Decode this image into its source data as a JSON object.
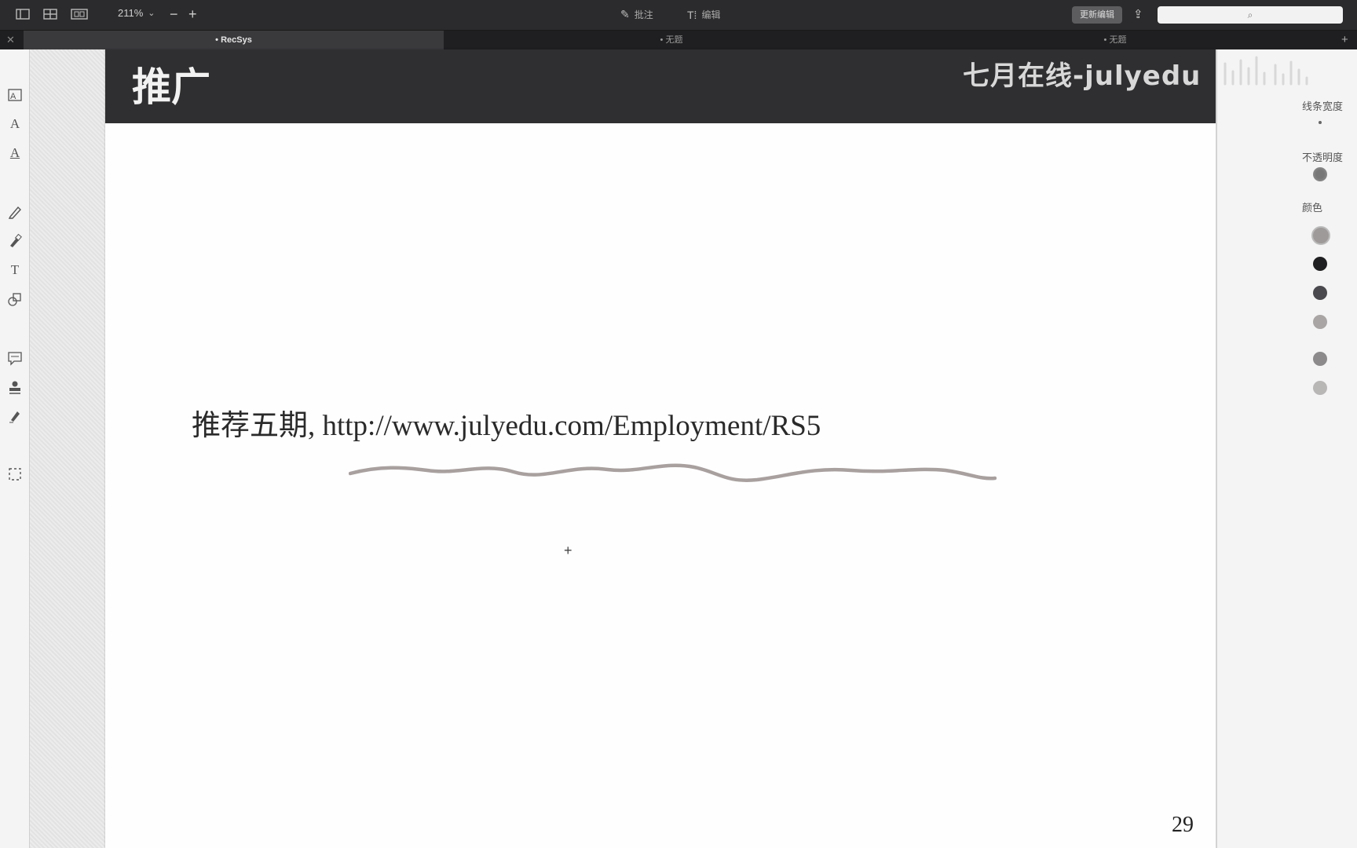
{
  "toolbar": {
    "zoom": "211%",
    "zoom_out": "−",
    "zoom_in": "+",
    "annotate": "批注",
    "edit": "编辑",
    "update_button": "更新编辑"
  },
  "tabs": [
    {
      "label": "• RecSys",
      "active": true
    },
    {
      "label": "• 无题",
      "active": false
    },
    {
      "label": "• 无题",
      "active": false
    }
  ],
  "slide": {
    "title": "推广",
    "watermark": "七月在线-julyedu",
    "promo_text": "推荐五期, http://www.julyedu.com/Employment/RS5",
    "page_number": "29"
  },
  "inspector": {
    "line_width_label": "线条宽度",
    "opacity_label": "不透明度",
    "color_label": "颜色",
    "colors": [
      "#9e9a99",
      "#1f1f21",
      "#4a4a4e",
      "#a9a5a4",
      "#8c8a8b",
      "#b9b6b6"
    ]
  },
  "annotation_color": "#a8a09f"
}
